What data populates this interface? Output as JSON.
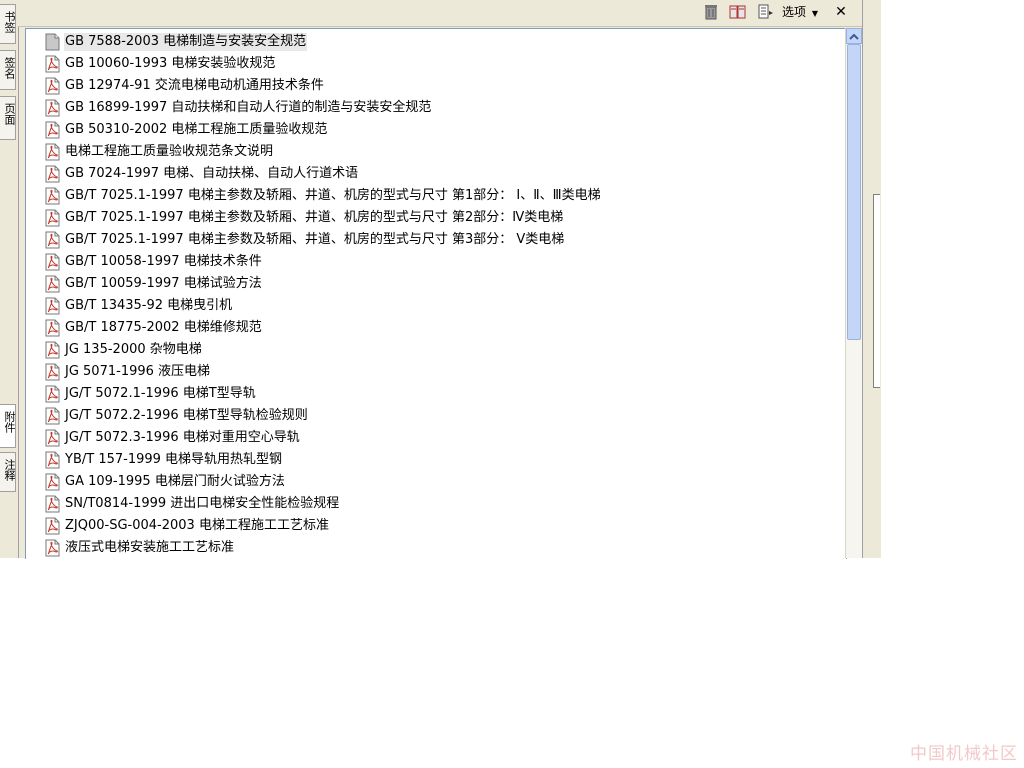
{
  "side_tabs": [
    "书签",
    "签名",
    "页面",
    "附件",
    "注释"
  ],
  "toolbar": {
    "icons": [
      "trash-icon",
      "open-document-icon",
      "attachment-options-icon"
    ],
    "options_label": "选项",
    "close_label": "✕"
  },
  "files": [
    {
      "label": "GB 7588-2003 电梯制造与安装安全规范",
      "icon": "file-generic-icon",
      "selected": true
    },
    {
      "label": "GB 10060-1993 电梯安装验收规范",
      "icon": "pdf-file-icon"
    },
    {
      "label": "GB 12974-91 交流电梯电动机通用技术条件",
      "icon": "pdf-file-icon"
    },
    {
      "label": "GB 16899-1997 自动扶梯和自动人行道的制造与安装安全规范",
      "icon": "pdf-file-icon"
    },
    {
      "label": "GB 50310-2002 电梯工程施工质量验收规范",
      "icon": "pdf-file-icon"
    },
    {
      "label": "电梯工程施工质量验收规范条文说明",
      "icon": "pdf-file-icon"
    },
    {
      "label": "GB 7024-1997 电梯、自动扶梯、自动人行道术语",
      "icon": "pdf-file-icon"
    },
    {
      "label": "GB/T 7025.1-1997 电梯主参数及轿厢、井道、机房的型式与尺寸 第1部分： Ⅰ、Ⅱ、Ⅲ类电梯",
      "icon": "pdf-file-icon"
    },
    {
      "label": "GB/T 7025.1-1997 电梯主参数及轿厢、井道、机房的型式与尺寸 第2部分：Ⅳ类电梯",
      "icon": "pdf-file-icon"
    },
    {
      "label": "GB/T 7025.1-1997 电梯主参数及轿厢、井道、机房的型式与尺寸 第3部分： Ⅴ类电梯",
      "icon": "pdf-file-icon"
    },
    {
      "label": "GB/T 10058-1997 电梯技术条件",
      "icon": "pdf-file-icon"
    },
    {
      "label": "GB/T 10059-1997 电梯试验方法",
      "icon": "pdf-file-icon"
    },
    {
      "label": "GB/T 13435-92 电梯曳引机",
      "icon": "pdf-file-icon"
    },
    {
      "label": "GB/T 18775-2002 电梯维修规范",
      "icon": "pdf-file-icon"
    },
    {
      "label": "JG 135-2000 杂物电梯",
      "icon": "pdf-file-icon"
    },
    {
      "label": "JG 5071-1996 液压电梯",
      "icon": "pdf-file-icon"
    },
    {
      "label": "JG/T 5072.1-1996 电梯T型导轨",
      "icon": "pdf-file-icon"
    },
    {
      "label": "JG/T 5072.2-1996 电梯T型导轨检验规则",
      "icon": "pdf-file-icon"
    },
    {
      "label": "JG/T 5072.3-1996 电梯对重用空心导轨",
      "icon": "pdf-file-icon"
    },
    {
      "label": "YB/T 157-1999 电梯导轨用热轧型钢",
      "icon": "pdf-file-icon"
    },
    {
      "label": "GA 109-1995 电梯层门耐火试验方法",
      "icon": "pdf-file-icon"
    },
    {
      "label": "SN/T0814-1999 进出口电梯安全性能检验规程",
      "icon": "pdf-file-icon"
    },
    {
      "label": "ZJQ00-SG-004-2003 电梯工程施工工艺标准",
      "icon": "pdf-file-icon"
    },
    {
      "label": "液压式电梯安装施工工艺标准",
      "icon": "pdf-file-icon"
    }
  ],
  "watermark": "中国机械社区",
  "colors": {
    "pdf_red": "#c0392b",
    "scroll_blue": "#c3d6f8",
    "chrome": "#ece9d8"
  }
}
